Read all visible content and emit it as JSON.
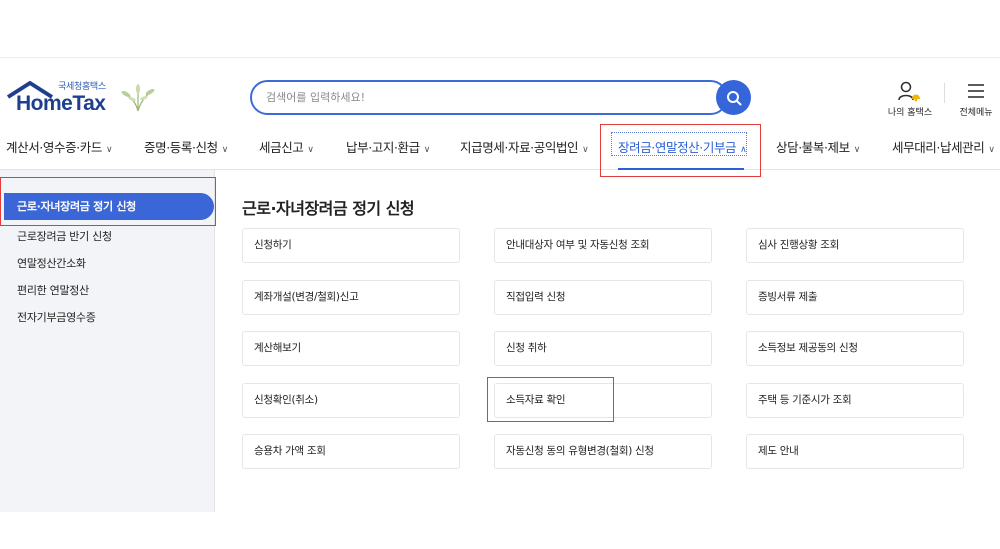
{
  "logo": {
    "sub": "국세청홈택스",
    "main": "HomeTax"
  },
  "search": {
    "placeholder": "검색어를 입력하세요!"
  },
  "header_links": [
    {
      "label": "나의 홈택스",
      "icon": "person-bell-icon"
    },
    {
      "label": "전체메뉴",
      "icon": "hamburger-menu-icon"
    }
  ],
  "gnb": [
    {
      "label": "계산서·영수증·카드"
    },
    {
      "label": "증명·등록·신청"
    },
    {
      "label": "세금신고"
    },
    {
      "label": "납부·고지·환급"
    },
    {
      "label": "지급명세·자료·공익법인"
    },
    {
      "label": "장려금·연말정산·기부금",
      "active": true
    },
    {
      "label": "상담·불복·제보"
    },
    {
      "label": "세무대리·납세관리"
    }
  ],
  "sidebar": {
    "items": [
      {
        "label": "근로·자녀장려금 정기 신청",
        "active": true
      },
      {
        "label": "근로장려금 반기 신청"
      },
      {
        "label": "연말정산간소화"
      },
      {
        "label": "편리한 연말정산"
      },
      {
        "label": "전자기부금영수증"
      }
    ]
  },
  "main": {
    "title": "근로·자녀장려금 정기 신청",
    "cards": [
      [
        "신청하기",
        "안내대상자 여부 및 자동신청 조회",
        "심사 진행상황 조회"
      ],
      [
        "계좌개설(변경/철회)신고",
        "직접입력 신청",
        "증빙서류 제출"
      ],
      [
        "계산해보기",
        "신청 취하",
        "소득정보 제공동의 신청"
      ],
      [
        "신청확인(취소)",
        "소득자료 확인",
        "주택 등 기준시가 조회"
      ],
      [
        "승용차 가액 조회",
        "자동신청 동의 유형변경(철회) 신청",
        "제도 안내"
      ]
    ]
  },
  "colors": {
    "accent": "#3565d8",
    "highlight": "#e23b3b",
    "sidebar_bg": "#f3f4f7"
  }
}
